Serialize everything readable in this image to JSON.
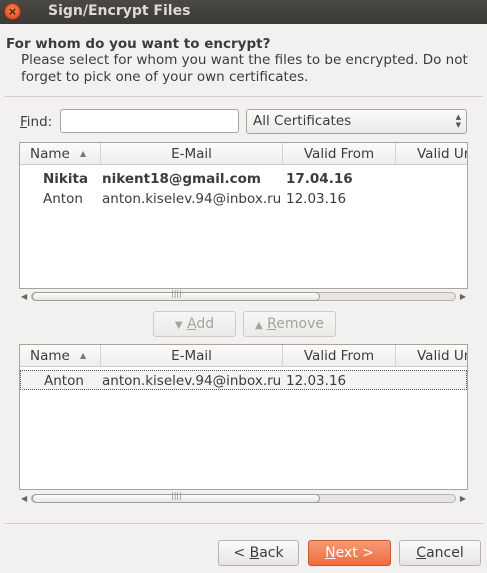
{
  "window": {
    "title": "Sign/Encrypt Files",
    "close_glyph": "×"
  },
  "heading": "For whom do you want to encrypt?",
  "instructions": "Please select for whom you want the files to be encrypted. Do not forget to pick one of your own certificates.",
  "find": {
    "label_mnemonic": "F",
    "label_rest": "ind:",
    "value": "",
    "placeholder": ""
  },
  "filter": {
    "selected": "All Certificates"
  },
  "columns": {
    "name": "Name",
    "email": "E-Mail",
    "valid_from": "Valid From",
    "valid_until": "Valid Ur"
  },
  "available": [
    {
      "name": "Nikita",
      "email": "nikent18@gmail.com",
      "valid_from": "17.04.16",
      "bold": true
    },
    {
      "name": "Anton",
      "email": "anton.kiselev.94@inbox.ru",
      "valid_from": "12.03.16",
      "bold": false
    }
  ],
  "selected": [
    {
      "name": "Anton",
      "email": "anton.kiselev.94@inbox.ru",
      "valid_from": "12.03.16"
    }
  ],
  "buttons": {
    "add_mnemonic": "A",
    "add_rest": "dd",
    "remove_mnemonic": "R",
    "remove_rest": "emove",
    "back_prefix": "< ",
    "back_mnemonic": "B",
    "back_rest": "ack",
    "next_mnemonic": "N",
    "next_rest": "ext >",
    "cancel_mnemonic": "C",
    "cancel_rest": "ancel"
  },
  "glyphs": {
    "sort": "▲",
    "arrow_down": "▼",
    "arrow_up": "▲",
    "scroll_left": "◀",
    "scroll_right": "▶",
    "grip": "||||",
    "combo_up": "▲",
    "combo_down": "▼"
  },
  "colors": {
    "accent": "#ee6b3c",
    "titlebar": "#3b3a36",
    "close": "#dd4814"
  }
}
